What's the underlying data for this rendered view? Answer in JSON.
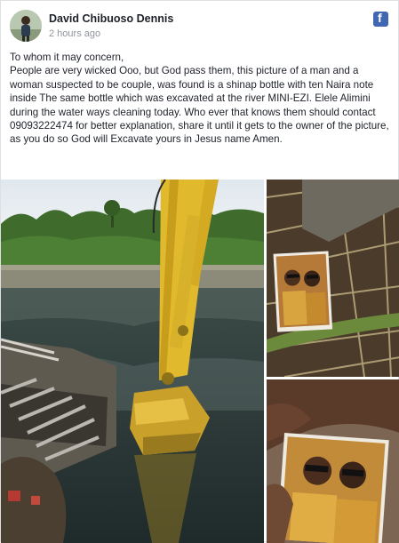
{
  "post": {
    "author": "David Chibuoso Dennis",
    "timestamp": "2 hours ago",
    "line1": "To whom it may concern,",
    "line2": "People are very wicked Ooo, but God pass them, this picture of a man and a woman suspected to be couple, was found is a shinap bottle with ten Naira note inside The same bottle which was excavated at the river MINI-EZI. Elele Alimini during the water ways cleaning today. Who ever that knows them should contact 09093222474 for better explanation, share it until it gets to the owner of the picture, as you do so God will Excavate yours in Jesus name Amen."
  },
  "icons": {
    "brand": "facebook-icon",
    "brand_color": "#4267b2"
  },
  "photos": {
    "main": "excavator-river-photo",
    "top_right": "photo-among-reeds",
    "bottom_right": "photo-held-in-hand"
  }
}
